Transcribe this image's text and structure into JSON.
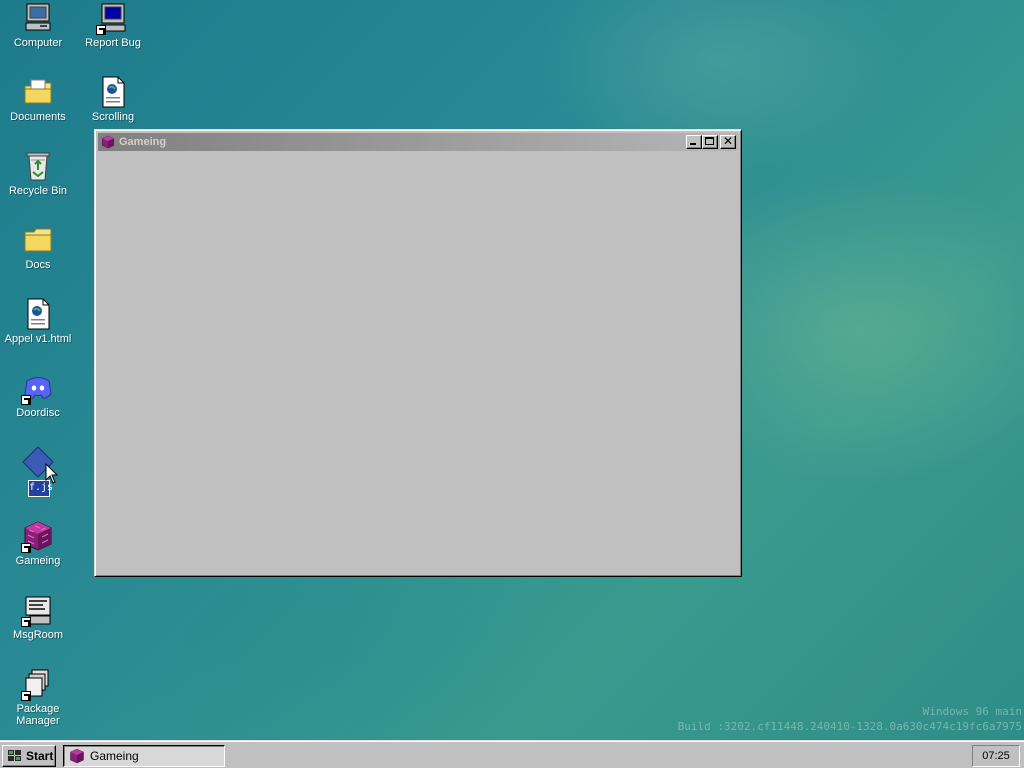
{
  "desktop": {
    "icons": [
      {
        "label": "Computer",
        "icon": "computer-icon"
      },
      {
        "label": "Report Bug",
        "icon": "report-bug-icon"
      },
      {
        "label": "Documents",
        "icon": "documents-folder-icon"
      },
      {
        "label": "Scrolling",
        "icon": "html-document-icon"
      },
      {
        "label": "Recycle Bin",
        "icon": "recycle-bin-icon"
      },
      {
        "label": "Docs",
        "icon": "folder-icon"
      },
      {
        "label": "Appel v1.html",
        "icon": "html-document-icon"
      },
      {
        "label": "Doordisc",
        "icon": "discord-icon"
      },
      {
        "label": "",
        "icon": "fjs-icon"
      },
      {
        "label": "Gameing",
        "icon": "game-cube-icon"
      },
      {
        "label": "MsgRoom",
        "icon": "msgroom-icon"
      },
      {
        "label": "Package Manager",
        "icon": "package-manager-icon"
      }
    ],
    "fjs_badge": "f.js"
  },
  "window": {
    "title": "Gameing",
    "icon": "game-cube-icon",
    "minimize_label": "_",
    "close_label": "✕"
  },
  "watermark": {
    "line1": "Windows 96 main",
    "line2": "Build :3202.cf11448.240410-1328.0a630c474c19fc6a7975"
  },
  "taskbar": {
    "start_label": "Start",
    "tasks": [
      {
        "label": "Gameing",
        "icon": "game-cube-icon",
        "active": true
      }
    ],
    "clock": "07:25"
  },
  "colors": {
    "desktop": "#2a8a94",
    "window_face": "#c0c0c0",
    "titlebar_inactive_start": "#808080",
    "titlebar_inactive_end": "#b5b5b5"
  }
}
